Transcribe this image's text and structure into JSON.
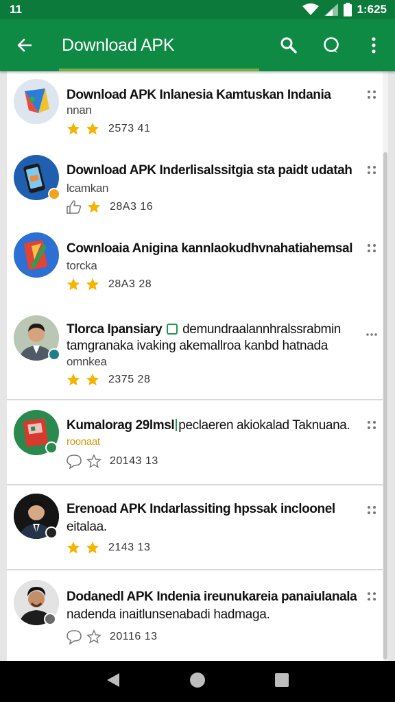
{
  "status_bar": {
    "time_left": "11",
    "time_right": "1:625"
  },
  "app_bar": {
    "title": "Download APK"
  },
  "items": [
    {
      "title": "Download APK Inlanesia Kamtuskan Indania",
      "sub": "nnan",
      "rating": "2573 41"
    },
    {
      "title": "Download APK Inderlisalssitgia sta paidt udatah",
      "sub": "lcamkan",
      "rating": "28A3 16"
    },
    {
      "title": "Cownloaia Anigina kannlaokudhvnahatiahemsal",
      "sub": "torcka",
      "rating": "28A3 28"
    },
    {
      "title": "Tlorca Ipansiary",
      "title_rest": "demundraalannhralssrabmin",
      "sub": "tamgranaka ivaking akemallroa kanbd hatnada",
      "sub2": "omnkea",
      "rating": "2375 28"
    },
    {
      "title": "Kumalorag 29lmsl",
      "title_rest": "peclaeren akiokalad Taknuana.",
      "sub": "roonaat",
      "rating": "20143 13"
    },
    {
      "title": "Erenoad APK Indarlassiting hpssak incloonel",
      "sub": "eitalaa.",
      "rating": "2143 13"
    },
    {
      "title": "Dodanedl APK Indenia ireunukareia panaiulanala",
      "sub": "nadenda inaitlunsenabadi hadmaga.",
      "rating": "20116 13"
    }
  ]
}
